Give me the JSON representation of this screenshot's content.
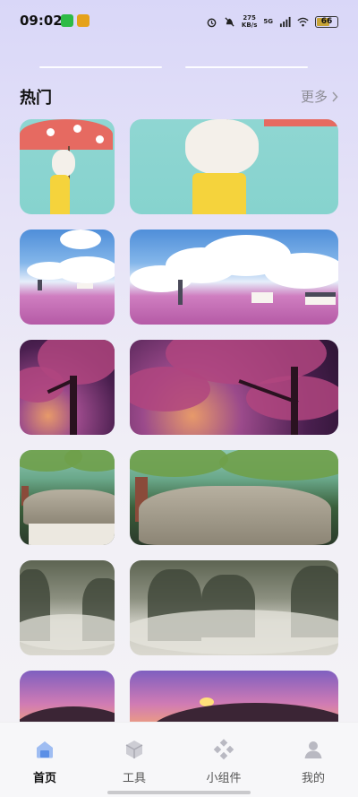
{
  "status_bar": {
    "time": "09:02",
    "net_speed_value": "275",
    "net_speed_unit": "KB/s",
    "signal_label": "5G",
    "battery": "66",
    "battery_level": 0.66
  },
  "section": {
    "title": "热门",
    "more_label": "更多"
  },
  "wallpapers": [
    {
      "name": "umbrella-girl"
    },
    {
      "name": "lavender-field-windmill"
    },
    {
      "name": "cherry-blossom-tree"
    },
    {
      "name": "thatched-cottage"
    },
    {
      "name": "misty-mountains"
    },
    {
      "name": "sunset-hills"
    }
  ],
  "bottom_nav": {
    "items": [
      {
        "label": "首页",
        "icon": "home-icon",
        "active": true
      },
      {
        "label": "工具",
        "icon": "cube-icon",
        "active": false
      },
      {
        "label": "小组件",
        "icon": "widgets-icon",
        "active": false
      },
      {
        "label": "我的",
        "icon": "profile-icon",
        "active": false
      }
    ]
  },
  "colors": {
    "accent": "#5b8fe6",
    "nav_inactive": "#b9b9c2"
  }
}
